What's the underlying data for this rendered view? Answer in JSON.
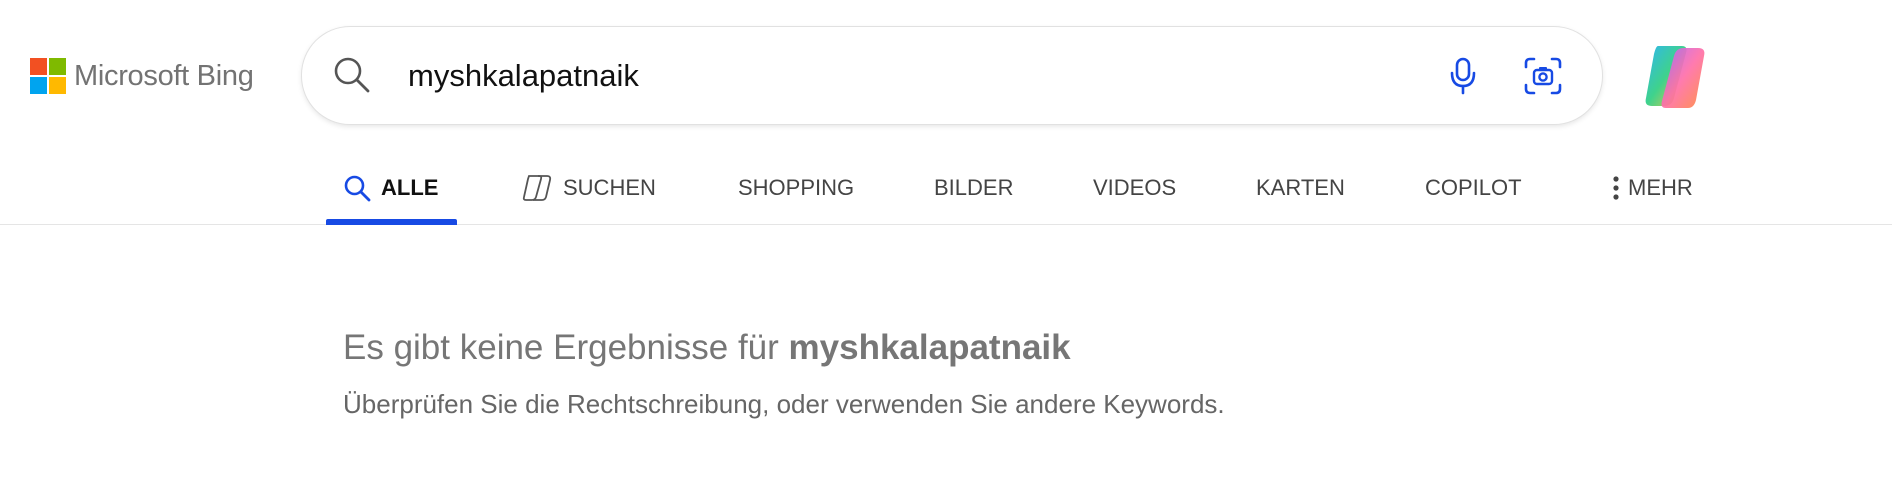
{
  "brand": {
    "logo_text": "Microsoft Bing",
    "square_colors": [
      "#f25022",
      "#7fba00",
      "#00a4ef",
      "#ffb900"
    ]
  },
  "search": {
    "query": "myshkalapatnaik",
    "search_icon": "search-icon",
    "mic_icon": "microphone-icon",
    "visual_search_icon": "visual-search-icon"
  },
  "copilot": {
    "icon": "copilot-logo-icon"
  },
  "tabs": [
    {
      "label": "ALLE",
      "icon": "search-icon",
      "active": true
    },
    {
      "label": "SUCHEN",
      "icon": "copilot-search-icon",
      "active": false
    },
    {
      "label": "SHOPPING",
      "active": false
    },
    {
      "label": "BILDER",
      "active": false
    },
    {
      "label": "VIDEOS",
      "active": false
    },
    {
      "label": "KARTEN",
      "active": false
    },
    {
      "label": "COPILOT",
      "active": false
    },
    {
      "label": "MEHR",
      "icon": "more-vertical-icon",
      "active": false
    }
  ],
  "colors": {
    "accent": "#174ae4",
    "mic_blue": "#174ae4"
  },
  "no_results": {
    "prefix": "Es gibt keine Ergebnisse für",
    "query": "myshkalapatnaik",
    "hint": "Überprüfen Sie die Rechtschreibung, oder verwenden Sie andere Keywords."
  }
}
